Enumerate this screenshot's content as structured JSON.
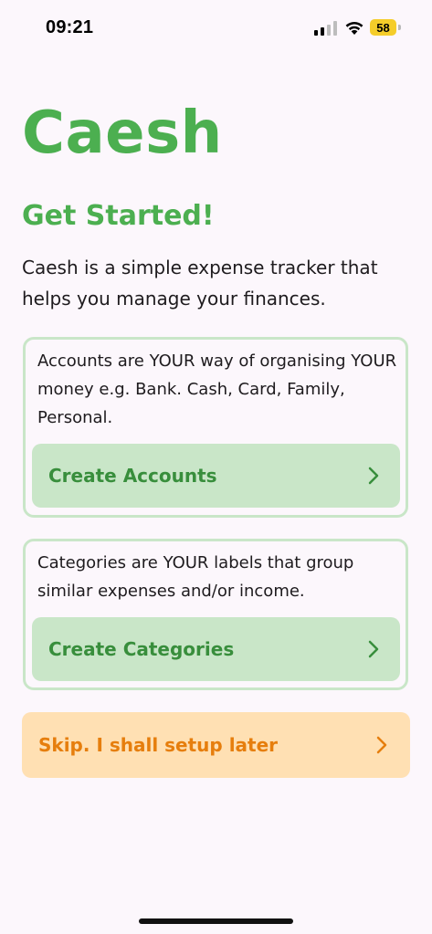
{
  "status_bar": {
    "time": "09:21",
    "battery_level": "58",
    "battery_color": "#f5cd2a"
  },
  "app": {
    "title": "Caesh",
    "subtitle": "Get Started!",
    "intro": "Caesh is a simple expense tracker that helps you manage your finances."
  },
  "accounts_card": {
    "description": "Accounts are YOUR way of organising YOUR money e.g. Bank. Cash, Card, Family, Personal.",
    "button_label": "Create Accounts",
    "button_icon": "chevron-right-icon"
  },
  "categories_card": {
    "description": "Categories are YOUR labels that group similar expenses and/or income.",
    "button_label": "Create Categories",
    "button_icon": "chevron-right-icon"
  },
  "skip": {
    "label": "Skip. I shall setup later",
    "icon": "chevron-right-icon"
  },
  "colors": {
    "primary": "#4caf50",
    "primary_dark": "#388e3c",
    "card_fill": "#c9e6c8",
    "skip_fill": "#ffe0b3",
    "skip_text": "#e67e0d",
    "background": "#fcf7fc"
  }
}
